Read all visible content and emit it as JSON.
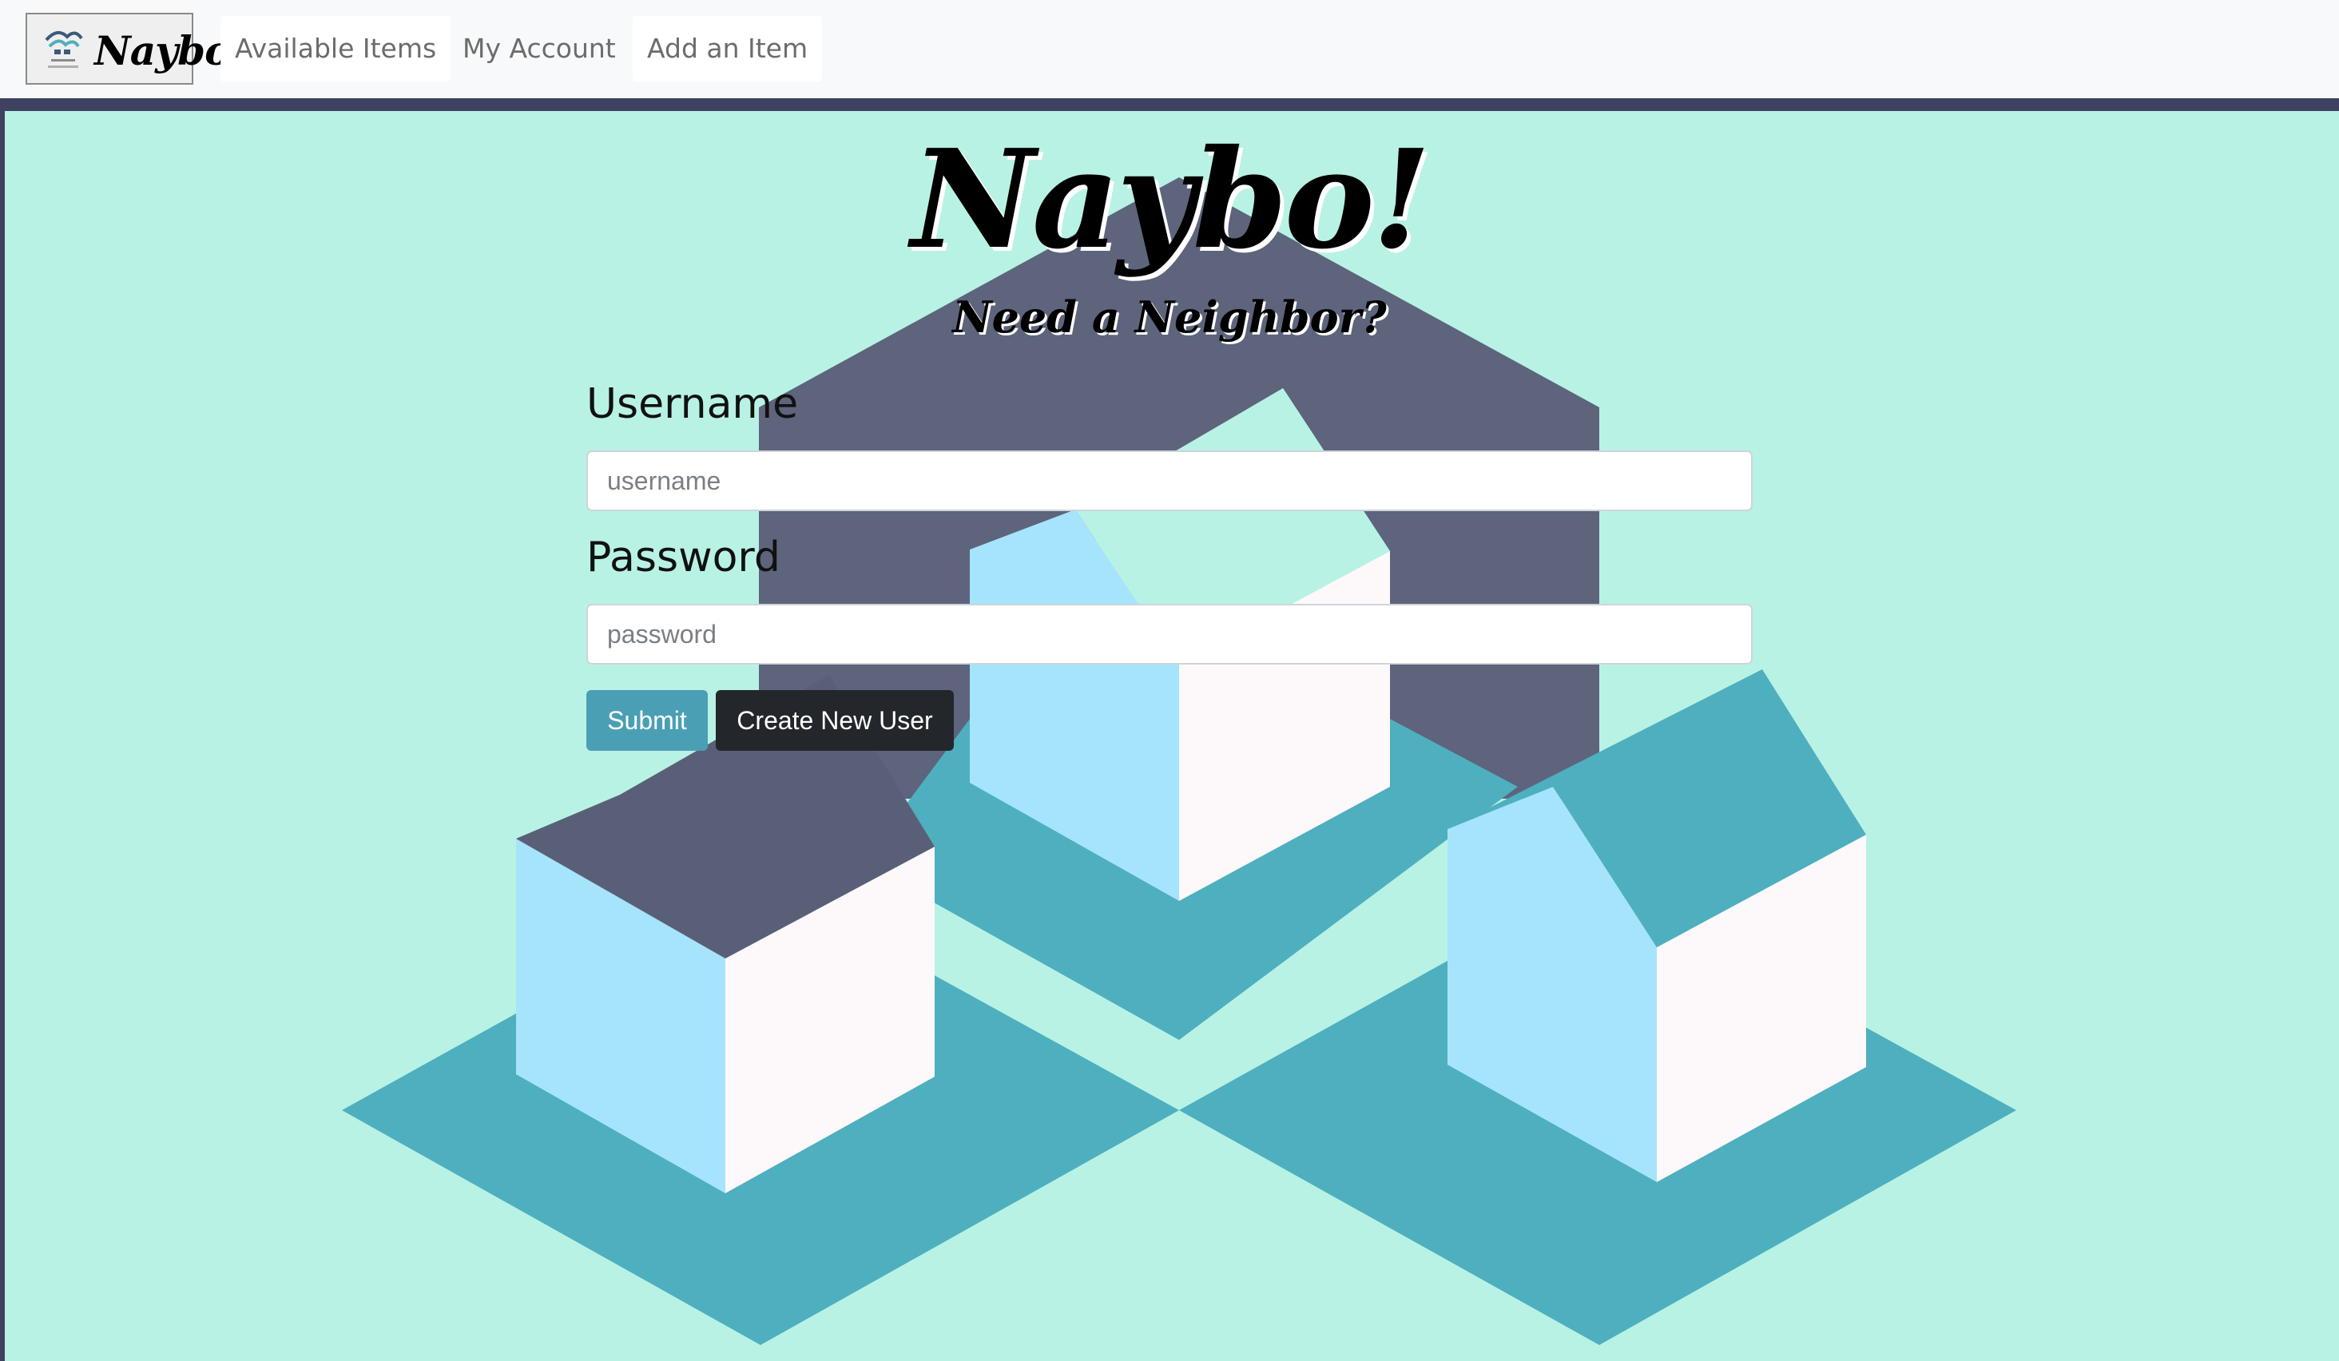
{
  "navbar": {
    "brand_text": "Naybo",
    "links": [
      {
        "label": "Available Items"
      },
      {
        "label": "My Account"
      },
      {
        "label": "Add an Item"
      }
    ]
  },
  "hero": {
    "title": "Naybo!",
    "subtitle": "Need a Neighbor?"
  },
  "login_form": {
    "username_label": "Username",
    "username_placeholder": "username",
    "password_label": "Password",
    "password_placeholder": "password",
    "submit_label": "Submit",
    "create_user_label": "Create New User"
  },
  "colors": {
    "background": "#b8f2e4",
    "navbar": "#f8f9fa",
    "frame": "#3e4160",
    "roof": "#5a5f78",
    "ground": "#4eafbf",
    "house_left_face": "#a6e4fc",
    "house_right_face": "#fdf8fa",
    "submit_button": "#4a9fb5",
    "create_button": "#23272b"
  }
}
